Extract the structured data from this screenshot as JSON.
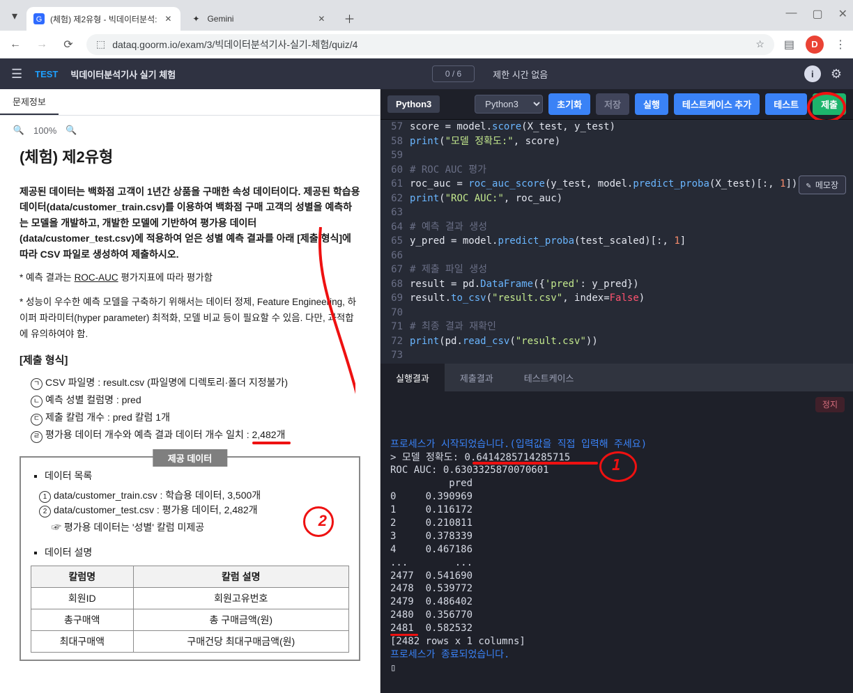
{
  "browser": {
    "tabs": [
      {
        "icon": "g-blue",
        "title": "(체험) 제2유형 - 빅데이터분석:"
      },
      {
        "icon": "spark",
        "title": "Gemini"
      }
    ],
    "url": "dataq.goorm.io/exam/3/빅데이터분석기사-실기-체험/quiz/4",
    "avatar_letter": "D"
  },
  "app_header": {
    "badge": "TEST",
    "title": "빅데이터분석기사 실기 체험",
    "progress": "0 / 6",
    "time": "제한 시간 없음"
  },
  "left": {
    "tab": "문제정보",
    "zoom": "100%",
    "heading": "(체험) 제2유형",
    "desc": "제공된 데이터는 백화점 고객이 1년간 상품을 구매한 속성 데이터이다. 제공된 학습용 데이터(data/customer_train.csv)를 이용하여 백화점 구매 고객의 성별을 예측하는 모델을 개발하고, 개발한 모델에 기반하여 평가용 데이터(data/customer_test.csv)에 적용하여 얻은 성별 예측 결과를 아래 [제출 형식]에 따라 CSV 파일로 생성하여 제출하시오.",
    "note1_prefix": "* 예측 결과는 ",
    "note1_u": "ROC-AUC",
    "note1_suffix": " 평가지표에 따라 평가함",
    "note2": "* 성능이 우수한 예측 모델을 구축하기 위해서는 데이터 정제, Feature Engineering, 하이퍼 파라미터(hyper parameter) 최적화, 모델 비교 등이 필요할 수 있음. 다만, 과적합에 유의하여야 함.",
    "submit_h": "[제출 형식]",
    "submit_items": [
      "CSV 파일명 : result.csv (파일명에 디렉토리·폴더 지정불가)",
      "예측 성별 컬럼명 : pred",
      "제출 칼럼 개수 : pred 칼럼 1개"
    ],
    "submit_last_a": "평가용 데이터 개수와 예측 결과 데이터 개수 일치 : ",
    "submit_last_b": "2,482개",
    "provided_tag": "제공 데이터",
    "provided_list_h": "데이터 목록",
    "provided_files": [
      "data/customer_train.csv : 학습용 데이터, 3,500개",
      "data/customer_test.csv  : 평가용 데이터, 2,482개"
    ],
    "provided_note": "☞ 평가용 데이터는 '성별' 칼럼 미제공",
    "provided_desc_h": "데이터 설명",
    "ptable": {
      "th1": "칼럼명",
      "th2": "칼럼 설명",
      "rows": [
        [
          "회원ID",
          "회원고유번호"
        ],
        [
          "총구매액",
          "총 구매금액(원)"
        ],
        [
          "최대구매액",
          "구매건당 최대구매금액(원)"
        ]
      ]
    }
  },
  "toolbar": {
    "lang": "Python3",
    "select": "Python3",
    "init": "초기화",
    "save": "저장",
    "run": "실행",
    "addcase": "테스트케이스 추가",
    "test": "테스트",
    "submit": "제출"
  },
  "memo": "메모장",
  "code": {
    "first_line_no": 57,
    "lines": [
      {
        "t": [
          {
            "c": "code",
            "s": "score = model."
          },
          {
            "c": "tok-call",
            "s": "score"
          },
          {
            "c": "code",
            "s": "(X_test, y_test)"
          }
        ]
      },
      {
        "t": [
          {
            "c": "tok-call",
            "s": "print"
          },
          {
            "c": "code",
            "s": "("
          },
          {
            "c": "tok-str",
            "s": "\"모델 정확도:\""
          },
          {
            "c": "code",
            "s": ", score)"
          }
        ]
      },
      {
        "t": []
      },
      {
        "t": [
          {
            "c": "tok-cm",
            "s": "# ROC AUC 평가"
          }
        ]
      },
      {
        "t": [
          {
            "c": "code",
            "s": "roc_auc = "
          },
          {
            "c": "tok-call",
            "s": "roc_auc_score"
          },
          {
            "c": "code",
            "s": "(y_test, model."
          },
          {
            "c": "tok-call",
            "s": "predict_proba"
          },
          {
            "c": "code",
            "s": "(X_test)[:, "
          },
          {
            "c": "tok-num",
            "s": "1"
          },
          {
            "c": "code",
            "s": "])"
          }
        ]
      },
      {
        "t": [
          {
            "c": "tok-call",
            "s": "print"
          },
          {
            "c": "code",
            "s": "("
          },
          {
            "c": "tok-str",
            "s": "\"ROC AUC:\""
          },
          {
            "c": "code",
            "s": ", roc_auc)"
          }
        ]
      },
      {
        "t": []
      },
      {
        "t": [
          {
            "c": "tok-cm",
            "s": "# 예측 결과 생성"
          }
        ]
      },
      {
        "t": [
          {
            "c": "code",
            "s": "y_pred = model."
          },
          {
            "c": "tok-call",
            "s": "predict_proba"
          },
          {
            "c": "code",
            "s": "(test_scaled)[:, "
          },
          {
            "c": "tok-num",
            "s": "1"
          },
          {
            "c": "code",
            "s": "]"
          }
        ]
      },
      {
        "t": []
      },
      {
        "t": [
          {
            "c": "tok-cm",
            "s": "# 제출 파일 생성"
          }
        ]
      },
      {
        "t": [
          {
            "c": "code",
            "s": "result = pd."
          },
          {
            "c": "tok-call",
            "s": "DataFrame"
          },
          {
            "c": "code",
            "s": "({"
          },
          {
            "c": "tok-str",
            "s": "'pred'"
          },
          {
            "c": "code",
            "s": ": y_pred})"
          }
        ]
      },
      {
        "t": [
          {
            "c": "code",
            "s": "result."
          },
          {
            "c": "tok-call",
            "s": "to_csv"
          },
          {
            "c": "code",
            "s": "("
          },
          {
            "c": "tok-str",
            "s": "\"result.csv\""
          },
          {
            "c": "code",
            "s": ", index="
          },
          {
            "c": "tok-const",
            "s": "False"
          },
          {
            "c": "code",
            "s": ")"
          }
        ]
      },
      {
        "t": []
      },
      {
        "t": [
          {
            "c": "tok-cm",
            "s": "# 최종 결과 재확인"
          }
        ]
      },
      {
        "t": [
          {
            "c": "tok-call",
            "s": "print"
          },
          {
            "c": "code",
            "s": "(pd."
          },
          {
            "c": "tok-call",
            "s": "read_csv"
          },
          {
            "c": "code",
            "s": "("
          },
          {
            "c": "tok-str",
            "s": "\"result.csv\""
          },
          {
            "c": "code",
            "s": "))"
          }
        ]
      },
      {
        "t": []
      }
    ]
  },
  "output_tabs": {
    "run": "실행결과",
    "submit": "제출결과",
    "test": "테스트케이스"
  },
  "console": {
    "stop": "정지",
    "l1": "프로세스가 시작되었습니다.(입력값을 직접 입력해 주세요)",
    "l2": "> 모델 정확도: 0.6414285714285715",
    "l3": "ROC AUC: 0.6303325870070601",
    "l4": "          pred",
    "rows": [
      "0     0.390969",
      "1     0.116172",
      "2     0.210811",
      "3     0.378339",
      "4     0.467186",
      "...        ...",
      "2477  0.541690",
      "2478  0.539772",
      "2479  0.486402",
      "2480  0.356770",
      "2481  0.582532"
    ],
    "foot1": "",
    "foot2": "[2482 rows x 1 columns]",
    "foot3": "",
    "end": "프로세스가 종료되었습니다.",
    "cursor": "▯"
  }
}
